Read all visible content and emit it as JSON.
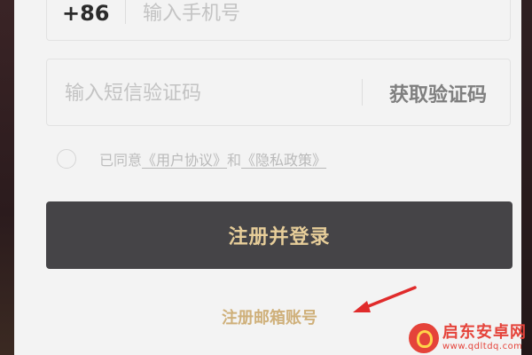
{
  "phone": {
    "country_code": "+86",
    "placeholder": "输入手机号",
    "value": ""
  },
  "sms": {
    "placeholder": "输入短信验证码",
    "value": "",
    "get_code_label": "获取验证码"
  },
  "agreement": {
    "checked": false,
    "prefix": "已同意",
    "user_agreement": "《用户协议》",
    "conjunction": "和",
    "privacy_policy": "《隐私政策》"
  },
  "register_button_label": "注册并登录",
  "email_register_label": "注册邮箱账号",
  "watermark": {
    "title": "启东安卓网",
    "url": "www.qdltdq.com"
  },
  "colors": {
    "button_bg": "#454447",
    "button_text": "#e6cd99",
    "gold_link": "#cfb07a",
    "annotation_arrow": "#e02b2b"
  },
  "icons": {
    "annotation": "red-arrow-icon",
    "watermark_logo": "qdltdq-logo-icon"
  }
}
